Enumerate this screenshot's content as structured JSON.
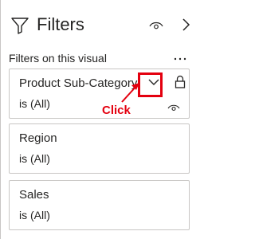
{
  "header": {
    "title": "Filters",
    "icons": {
      "filter": "filter-funnel-icon",
      "visibility": "eye-icon",
      "collapse": "chevron-right-icon"
    }
  },
  "section": {
    "label": "Filters on this visual",
    "more": "⋯"
  },
  "filters": [
    {
      "name": "Product Sub-Category",
      "value": "is (All)"
    },
    {
      "name": "Region",
      "value": "is (All)"
    },
    {
      "name": "Sales",
      "value": "is (All)"
    }
  ],
  "annotation": {
    "label": "Click",
    "color": "#e4000f"
  }
}
